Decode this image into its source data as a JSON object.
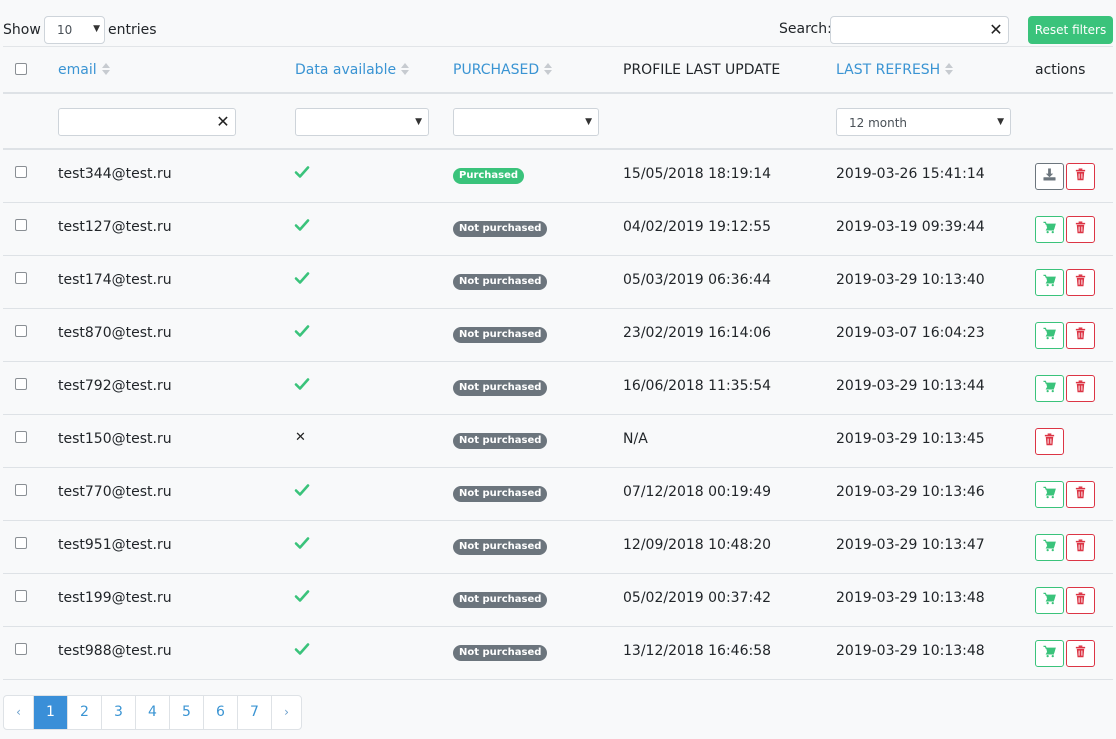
{
  "length_control": {
    "show_label": "Show",
    "value": "10",
    "entries_label": "entries"
  },
  "search": {
    "label": "Search:",
    "value": ""
  },
  "reset_filters_label": "Reset filters",
  "columns": {
    "email": "email",
    "data_available": "Data available",
    "purchased": "PURCHASED",
    "profile_last_update": "PROFILE LAST UPDATE",
    "last_refresh": "LAST REFRESH",
    "actions": "actions"
  },
  "filters": {
    "email": "",
    "data_available": "",
    "purchased": "",
    "last_refresh": "12 month"
  },
  "rows": [
    {
      "email": "test344@test.ru",
      "data_available": true,
      "purchased": "Purchased",
      "profile_last_update": "15/05/2018 18:19:14",
      "last_refresh": "2019-03-26 15:41:14",
      "action": "download"
    },
    {
      "email": "test127@test.ru",
      "data_available": true,
      "purchased": "Not purchased",
      "profile_last_update": "04/02/2019 19:12:55",
      "last_refresh": "2019-03-19 09:39:44",
      "action": "cart"
    },
    {
      "email": "test174@test.ru",
      "data_available": true,
      "purchased": "Not purchased",
      "profile_last_update": "05/03/2019 06:36:44",
      "last_refresh": "2019-03-29 10:13:40",
      "action": "cart"
    },
    {
      "email": "test870@test.ru",
      "data_available": true,
      "purchased": "Not purchased",
      "profile_last_update": "23/02/2019 16:14:06",
      "last_refresh": "2019-03-07 16:04:23",
      "action": "cart"
    },
    {
      "email": "test792@test.ru",
      "data_available": true,
      "purchased": "Not purchased",
      "profile_last_update": "16/06/2018 11:35:54",
      "last_refresh": "2019-03-29 10:13:44",
      "action": "cart"
    },
    {
      "email": "test150@test.ru",
      "data_available": false,
      "purchased": "Not purchased",
      "profile_last_update": "N/A",
      "last_refresh": "2019-03-29 10:13:45",
      "action": "none"
    },
    {
      "email": "test770@test.ru",
      "data_available": true,
      "purchased": "Not purchased",
      "profile_last_update": "07/12/2018 00:19:49",
      "last_refresh": "2019-03-29 10:13:46",
      "action": "cart"
    },
    {
      "email": "test951@test.ru",
      "data_available": true,
      "purchased": "Not purchased",
      "profile_last_update": "12/09/2018 10:48:20",
      "last_refresh": "2019-03-29 10:13:47",
      "action": "cart"
    },
    {
      "email": "test199@test.ru",
      "data_available": true,
      "purchased": "Not purchased",
      "profile_last_update": "05/02/2019 00:37:42",
      "last_refresh": "2019-03-29 10:13:48",
      "action": "cart"
    },
    {
      "email": "test988@test.ru",
      "data_available": true,
      "purchased": "Not purchased",
      "profile_last_update": "13/12/2018 16:46:58",
      "last_refresh": "2019-03-29 10:13:48",
      "action": "cart"
    }
  ],
  "pagination": {
    "prev": "‹",
    "next": "›",
    "pages": [
      "1",
      "2",
      "3",
      "4",
      "5",
      "6",
      "7"
    ],
    "current": "1"
  },
  "colors": {
    "accent": "#3a94d3",
    "success": "#3ac37b",
    "danger": "#dc3545",
    "muted": "#6c757d"
  },
  "icons": {
    "available": "check-icon",
    "unavailable": "cross-icon",
    "delete": "trash-icon",
    "buy": "cart-icon",
    "download": "download-icon"
  }
}
